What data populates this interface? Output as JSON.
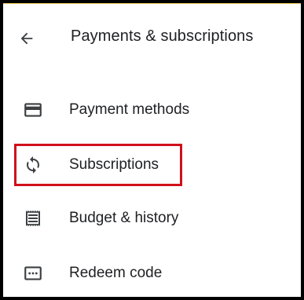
{
  "header": {
    "title": "Payments & subscriptions",
    "back_icon": "arrow-back-icon"
  },
  "menu": {
    "items": [
      {
        "label": "Payment methods",
        "icon": "credit-card-icon"
      },
      {
        "label": "Subscriptions",
        "icon": "sync-icon",
        "highlighted": true
      },
      {
        "label": "Budget & history",
        "icon": "receipt-icon"
      },
      {
        "label": "Redeem code",
        "icon": "redeem-code-icon"
      }
    ]
  },
  "colors": {
    "text": "#202124",
    "icon": "#3c4043",
    "highlight_border": "#d0101c",
    "background": "#ffffff"
  }
}
